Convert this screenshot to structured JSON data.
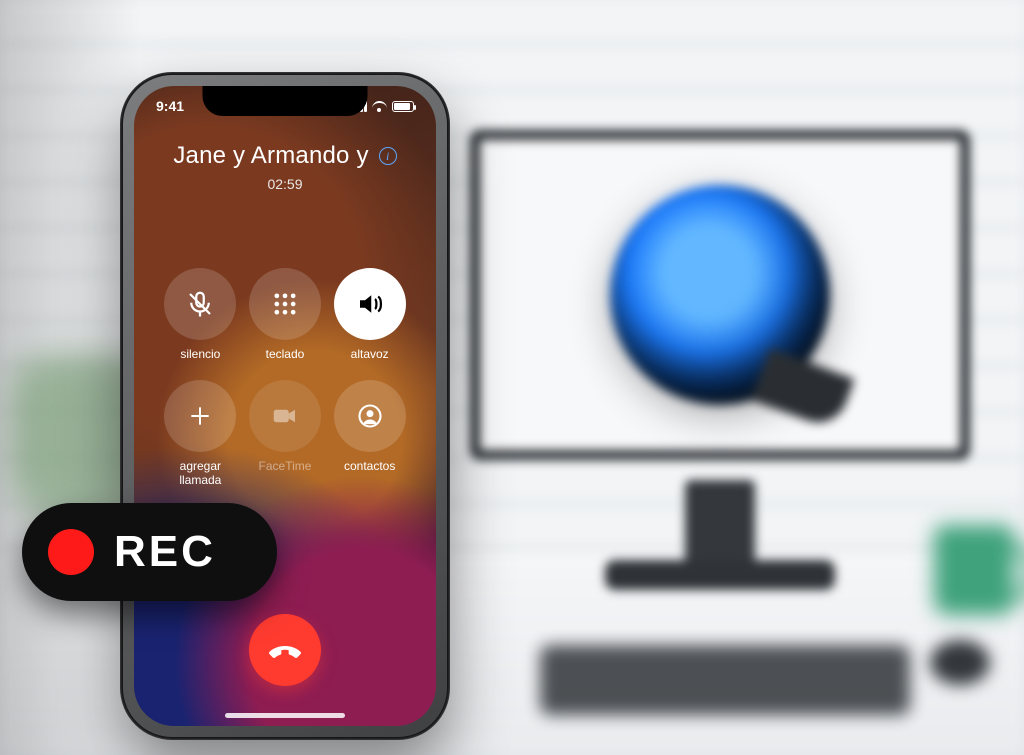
{
  "status": {
    "time": "9:41"
  },
  "call": {
    "caller": "Jane y Armando y",
    "duration": "02:59"
  },
  "buttons": {
    "mute": {
      "label": "silencio"
    },
    "keypad": {
      "label": "teclado"
    },
    "speaker": {
      "label": "altavoz"
    },
    "add": {
      "label": "agregar\nllamada"
    },
    "facetime": {
      "label": "FaceTime"
    },
    "contacts": {
      "label": "contactos"
    }
  },
  "rec": {
    "label": "REC"
  }
}
